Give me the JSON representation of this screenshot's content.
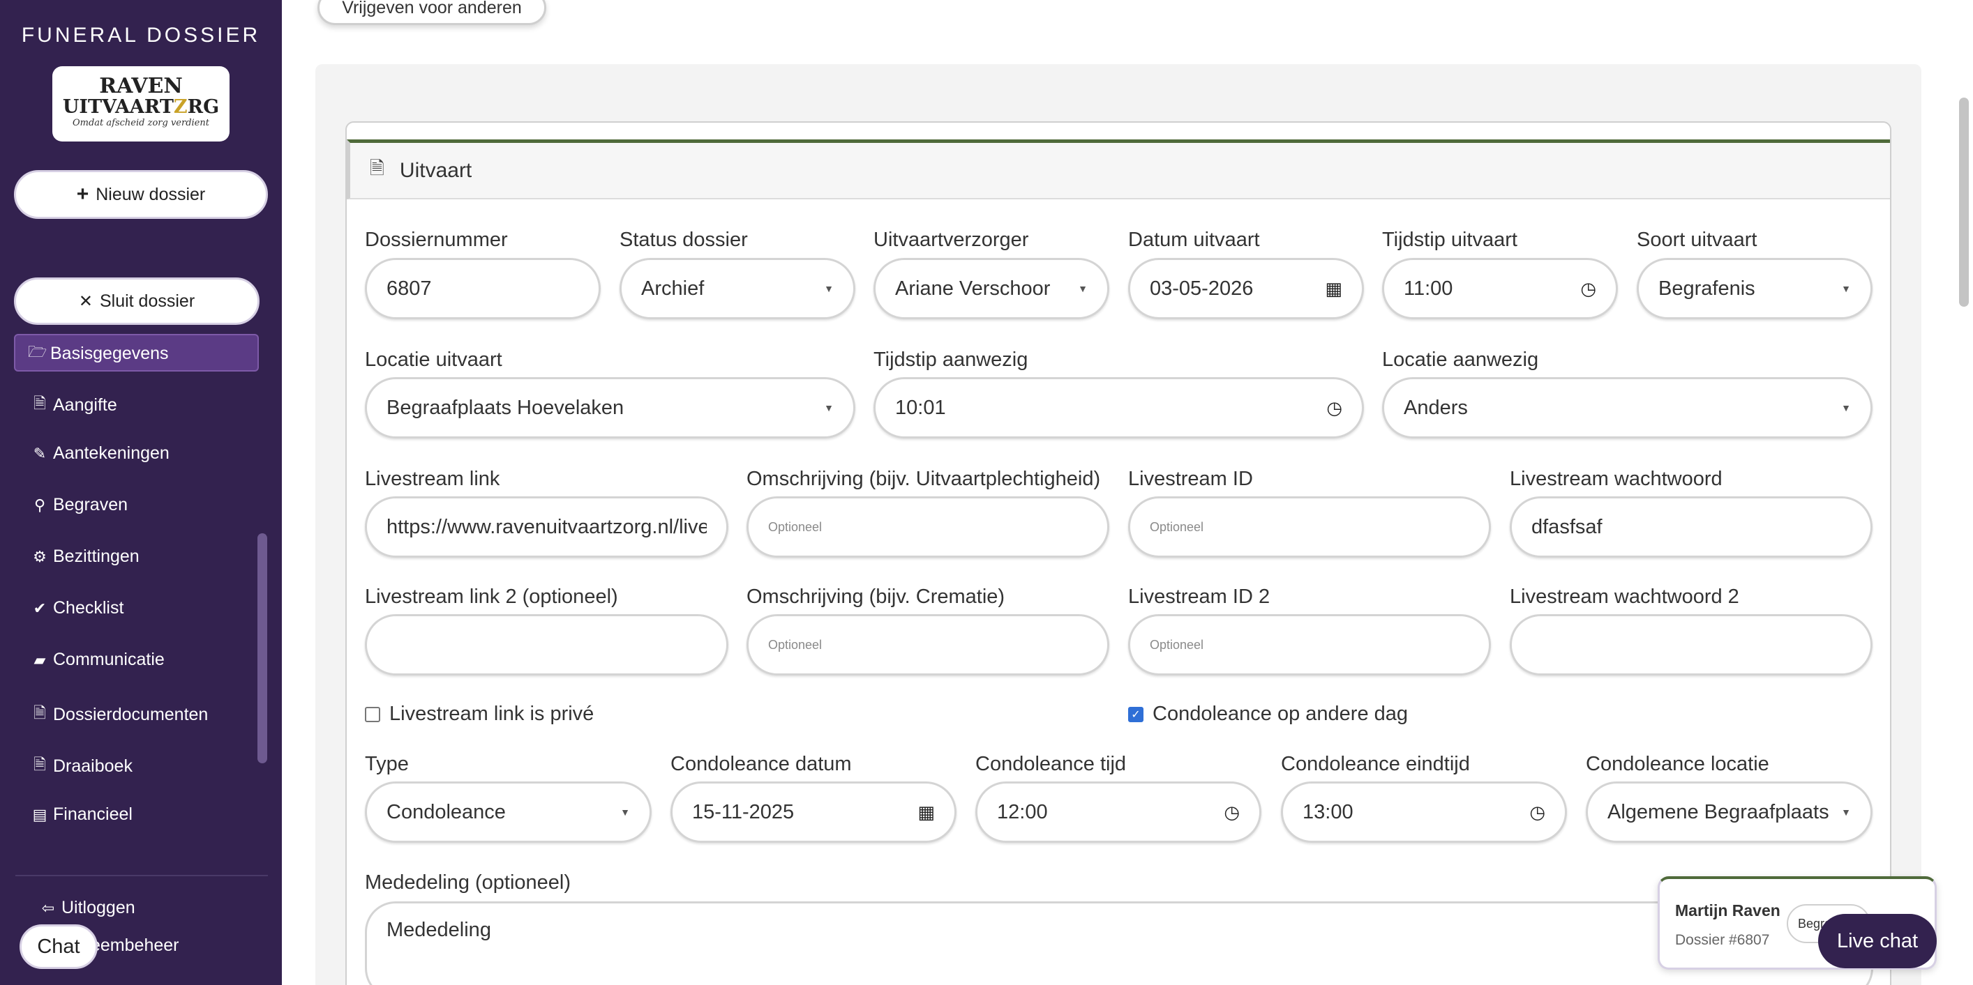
{
  "sidebar": {
    "brand": "FUNERAL DOSSIER",
    "logo": {
      "line1": "RAVEN",
      "line2a": "UITVAART",
      "line2b": "Z",
      "line2c": "RG",
      "tagline": "Omdat afscheid zorg verdient"
    },
    "new_dossier": "Nieuw dossier",
    "close_dossier": "Sluit dossier",
    "items": [
      {
        "icon": "folder-open-icon",
        "glyph": "🗁",
        "label": "Basisgegevens"
      },
      {
        "icon": "file-icon",
        "glyph": "🗎",
        "label": "Aangifte"
      },
      {
        "icon": "pencil-icon",
        "glyph": "✎",
        "label": "Aantekeningen"
      },
      {
        "icon": "map-pin-icon",
        "glyph": "⚲",
        "label": "Begraven"
      },
      {
        "icon": "gear-icon",
        "glyph": "⚙",
        "label": "Bezittingen"
      },
      {
        "icon": "check-circle-icon",
        "glyph": "✔",
        "label": "Checklist"
      },
      {
        "icon": "chat-bubble-icon",
        "glyph": "▰",
        "label": "Communicatie"
      },
      {
        "icon": "file-icon",
        "glyph": "🗎",
        "label": "Dossierdocumenten"
      },
      {
        "icon": "file-icon",
        "glyph": "🗎",
        "label": "Draaiboek"
      },
      {
        "icon": "money-icon",
        "glyph": "▤",
        "label": "Financieel"
      }
    ],
    "logout": "Uitloggen",
    "system": "eembeheer",
    "chat": "Chat"
  },
  "top_button": "Vrijgeven voor anderen",
  "section_title": "Uitvaart",
  "fields": {
    "dossiernummer": {
      "label": "Dossiernummer",
      "value": "6807"
    },
    "status": {
      "label": "Status dossier",
      "value": "Archief"
    },
    "verzorger": {
      "label": "Uitvaartverzorger",
      "value": "Ariane Verschoor"
    },
    "datum": {
      "label": "Datum uitvaart",
      "value": "03-05-2026"
    },
    "tijdstip": {
      "label": "Tijdstip uitvaart",
      "value": "11:00"
    },
    "soort": {
      "label": "Soort uitvaart",
      "value": "Begrafenis"
    },
    "locatie": {
      "label": "Locatie uitvaart",
      "value": "Begraafplaats Hoevelaken"
    },
    "aanwezig_tijd": {
      "label": "Tijdstip aanwezig",
      "value": "10:01"
    },
    "aanwezig_locatie": {
      "label": "Locatie aanwezig",
      "value": "Anders"
    },
    "ls_link": {
      "label": "Livestream link",
      "value": "https://www.ravenuitvaartzorg.nl/live"
    },
    "ls_omschrijving": {
      "label": "Omschrijving (bijv. Uitvaartplechtigheid)",
      "placeholder": "Optioneel"
    },
    "ls_id": {
      "label": "Livestream ID",
      "placeholder": "Optioneel"
    },
    "ls_pw": {
      "label": "Livestream wachtwoord",
      "value": "dfasfsaf"
    },
    "ls_link2": {
      "label": "Livestream link 2 (optioneel)",
      "value": ""
    },
    "ls_omschrijving2": {
      "label": "Omschrijving (bijv. Crematie)",
      "placeholder": "Optioneel"
    },
    "ls_id2": {
      "label": "Livestream ID 2",
      "placeholder": "Optioneel"
    },
    "ls_pw2": {
      "label": "Livestream wachtwoord 2",
      "value": ""
    },
    "type": {
      "label": "Type",
      "value": "Condoleance"
    },
    "cond_datum": {
      "label": "Condoleance datum",
      "value": "15-11-2025"
    },
    "cond_tijd": {
      "label": "Condoleance tijd",
      "value": "12:00"
    },
    "cond_eind": {
      "label": "Condoleance eindtijd",
      "value": "13:00"
    },
    "cond_locatie": {
      "label": "Condoleance locatie",
      "value": "Algemene Begraafplaats"
    },
    "mededeling": {
      "label": "Mededeling (optioneel)",
      "value": "Mededeling"
    }
  },
  "checkboxes": {
    "prive": {
      "label": "Livestream link is privé",
      "checked": false
    },
    "andere_dag": {
      "label": "Condoleance op andere dag",
      "checked": true
    }
  },
  "chat_popover": {
    "name": "Martijn Raven",
    "dossier": "Dossier #6807",
    "pill": "Begra"
  },
  "live_chat": "Live chat"
}
